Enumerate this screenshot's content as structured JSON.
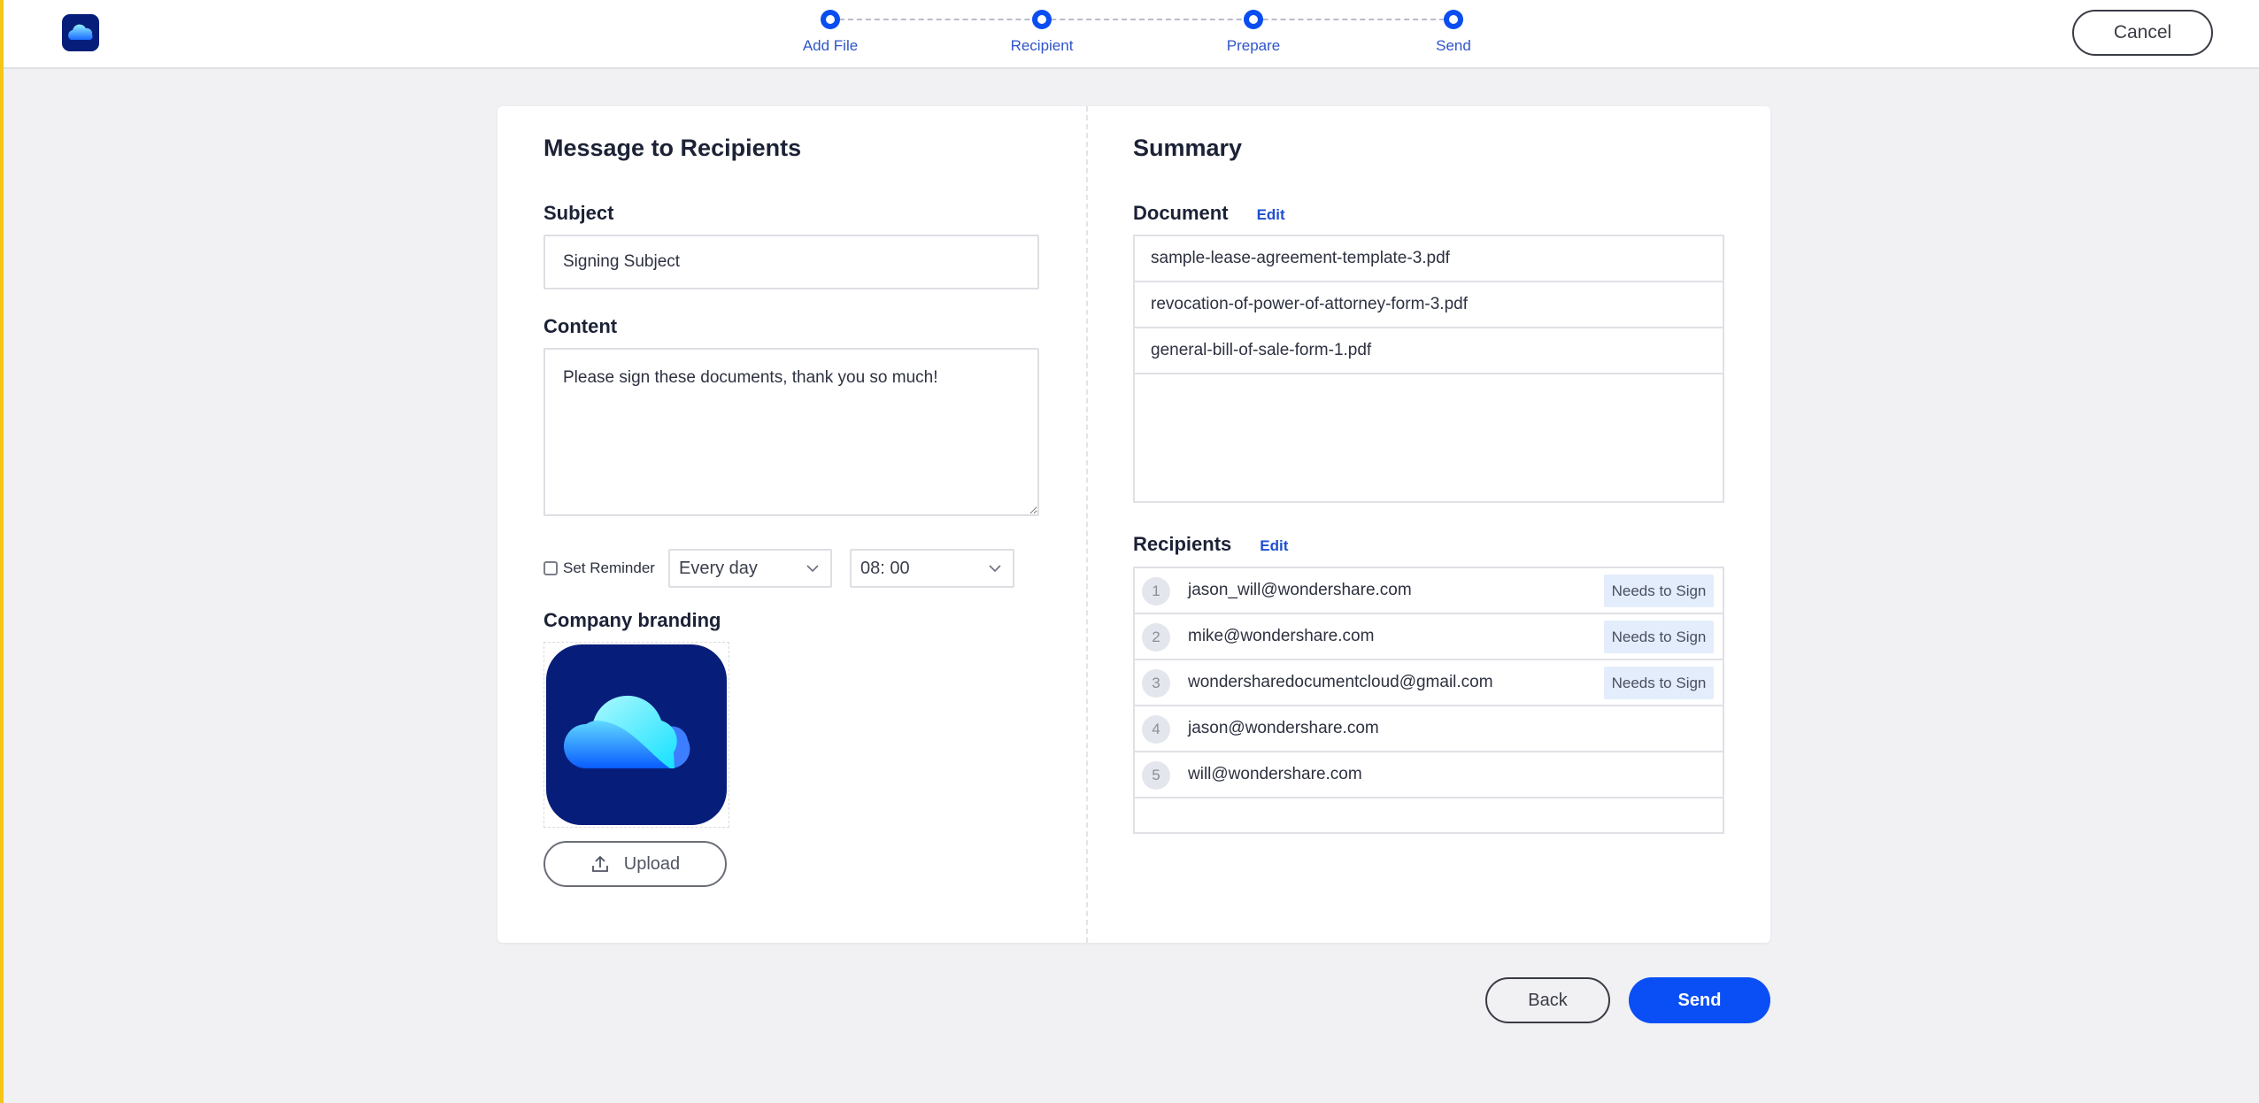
{
  "header": {
    "logo": "wondershare-document-cloud-logo",
    "steps": [
      {
        "label": "Add File"
      },
      {
        "label": "Recipient"
      },
      {
        "label": "Prepare"
      },
      {
        "label": "Send"
      }
    ],
    "cancel_label": "Cancel"
  },
  "message": {
    "title": "Message to Recipients",
    "subject_label": "Subject",
    "subject_value": "Signing Subject",
    "content_label": "Content",
    "content_value": "Please sign these documents, thank you so much!",
    "reminder": {
      "label": "Set Reminder",
      "checked": false,
      "frequency": "Every day",
      "time": "08: 00"
    },
    "branding_label": "Company branding",
    "upload_label": "Upload"
  },
  "summary": {
    "title": "Summary",
    "document_label": "Document",
    "document_edit": "Edit",
    "documents": [
      {
        "name": "sample-lease-agreement-template-3.pdf"
      },
      {
        "name": "revocation-of-power-of-attorney-form-3.pdf"
      },
      {
        "name": "general-bill-of-sale-form-1.pdf"
      }
    ],
    "recipients_label": "Recipients",
    "recipients_edit": "Edit",
    "recipients": [
      {
        "num": "1",
        "email": "jason_will@wondershare.com",
        "role": "Needs to Sign"
      },
      {
        "num": "2",
        "email": "mike@wondershare.com",
        "role": "Needs to Sign"
      },
      {
        "num": "3",
        "email": "wondersharedocumentcloud@gmail.com",
        "role": "Needs to Sign"
      },
      {
        "num": "4",
        "email": "jason@wondershare.com",
        "role": ""
      },
      {
        "num": "5",
        "email": "will@wondershare.com",
        "role": ""
      }
    ]
  },
  "footer": {
    "back_label": "Back",
    "send_label": "Send"
  },
  "colors": {
    "accent": "#0a4ff5",
    "link": "#1f4fd1",
    "step": "#0a4df0",
    "badge_bg": "#e3edfc",
    "window_accent": "#f5c518"
  }
}
